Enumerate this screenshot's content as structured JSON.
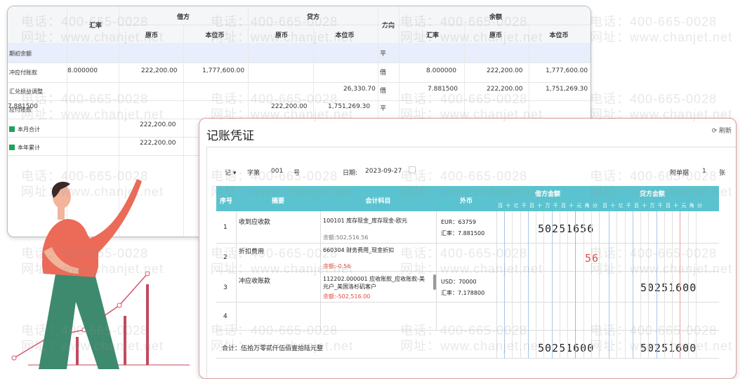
{
  "watermark": {
    "phone": "电话：400-665-0028",
    "site": "网址：www.chanjet.net"
  },
  "ledger": {
    "headers": {
      "rate": "汇率",
      "debit": "借方",
      "debit_orig": "原币",
      "debit_base": "本位币",
      "credit": "贷方",
      "credit_orig": "原币",
      "credit_base": "本位币",
      "direction": "方向",
      "balance": "余额",
      "balance_rate": "汇率",
      "balance_orig": "原币",
      "balance_base": "本位币"
    },
    "rows": [
      {
        "label": "期初余额",
        "rate": "",
        "d_orig": "",
        "d_base": "",
        "c_orig": "",
        "c_base": "",
        "dir": "平",
        "b_rate": "",
        "b_orig": "",
        "b_base": ""
      },
      {
        "label": "冲应付账款",
        "rate": "8.000000",
        "d_orig": "222,200.00",
        "d_base": "1,777,600.00",
        "c_orig": "",
        "c_base": "",
        "dir": "借",
        "b_rate": "8.000000",
        "b_orig": "222,200.00",
        "b_base": "1,777,600.00"
      },
      {
        "label": "汇兑损益调整",
        "rate": "",
        "d_orig": "",
        "d_base": "",
        "c_orig": "",
        "c_base": "26,330.70",
        "dir": "借",
        "b_rate": "7.881500",
        "b_orig": "222,200.00",
        "b_base": "1,751,269.30"
      },
      {
        "label": "应付账款",
        "rate": "7.881500",
        "d_orig": "",
        "d_base": "",
        "c_orig": "222,200.00",
        "c_base": "1,751,269.30",
        "dir": "平",
        "b_rate": "",
        "b_orig": "",
        "b_base": ""
      },
      {
        "label": "本月合计",
        "rate": "",
        "d_orig": "222,200.00",
        "d_base": "",
        "c_orig": "",
        "c_base": "",
        "dir": "",
        "b_rate": "",
        "b_orig": "",
        "b_base": ""
      },
      {
        "label": "本年累计",
        "rate": "",
        "d_orig": "222,200.00",
        "d_base": "",
        "c_orig": "",
        "c_base": "",
        "dir": "",
        "b_rate": "",
        "b_orig": "",
        "b_base": ""
      }
    ]
  },
  "voucher": {
    "title": "记账凭证",
    "refresh": "刷新",
    "type": "记",
    "zi_label": "字第",
    "number": "001",
    "hao": "号",
    "date_label": "日期:",
    "date": "2023-09-27",
    "attach_label": "附单据",
    "attach_count": "1",
    "attach_unit": "张",
    "table_headers": {
      "seq": "序号",
      "summary": "摘要",
      "account": "会计科目",
      "currency": "外币",
      "debit": "借方金额",
      "credit": "贷方金额"
    },
    "digit_units": [
      "百",
      "十",
      "亿",
      "千",
      "百",
      "十",
      "万",
      "千",
      "百",
      "十",
      "元",
      "角",
      "分"
    ],
    "rows": [
      {
        "seq": "1",
        "summary": "收到应收款",
        "account": "100101 库存现金_库存现金-欧元",
        "balance": "余额:502,516.56",
        "cur1": "EUR：63759",
        "cur2": "汇率：7.881500",
        "debit": "50251656",
        "credit": ""
      },
      {
        "seq": "2",
        "summary": "折扣费用",
        "account": "660304 财务费用_现金折扣",
        "balance": "余额:-0.56",
        "cur1": "",
        "cur2": "",
        "debit": "56",
        "credit": ""
      },
      {
        "seq": "3",
        "summary": "冲应收账款",
        "account": "112202.000001 应收账款_应收账款-美元户_美国洛杉矶客户",
        "balance": "余额:-502,516.00",
        "cur1": "USD：70000",
        "cur2": "汇率：7.178800",
        "debit": "",
        "credit": "50251600"
      },
      {
        "seq": "4",
        "summary": "",
        "account": "",
        "balance": "",
        "cur1": "",
        "cur2": "",
        "debit": "",
        "credit": ""
      }
    ],
    "total_label": "合计：伍拾万零贰仟伍佰壹拾陆元整",
    "total_debit": "50251600",
    "total_credit": "50251600"
  }
}
